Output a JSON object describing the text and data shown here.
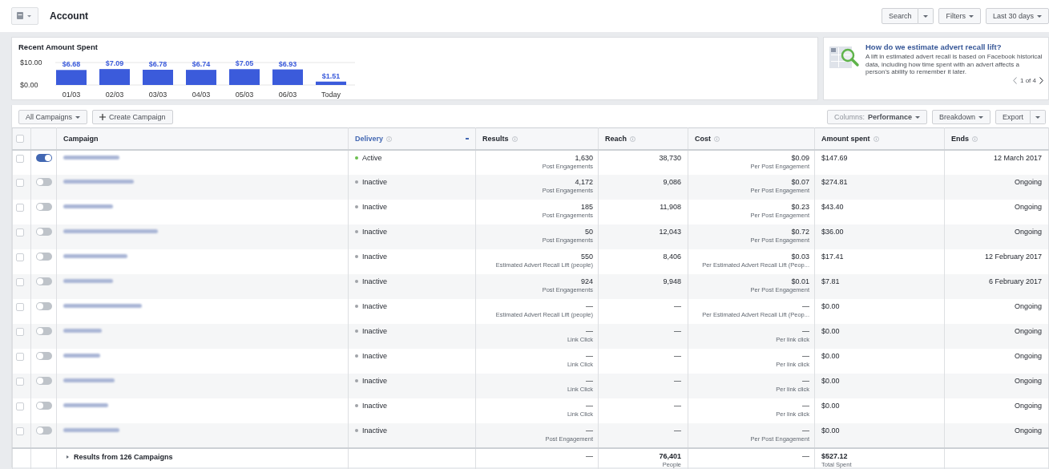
{
  "header": {
    "title": "Account",
    "buttons": [
      {
        "label": "Search",
        "kind": "split"
      },
      {
        "label": "Filters",
        "kind": "dropdown"
      },
      {
        "label": "Last 30 days",
        "kind": "dropdown"
      }
    ]
  },
  "spend_panel": {
    "title": "Recent Amount Spent",
    "chart_data": {
      "type": "bar",
      "categories": [
        "01/03",
        "02/03",
        "03/03",
        "04/03",
        "05/03",
        "06/03",
        "Today"
      ],
      "values": [
        6.68,
        7.09,
        6.78,
        6.74,
        7.05,
        6.93,
        1.51
      ],
      "yticks": [
        {
          "value": 0,
          "label": "$0.00"
        },
        {
          "value": 10,
          "label": "$10.00"
        }
      ],
      "ylim": [
        0,
        10
      ],
      "value_labels": [
        "$6.68",
        "$7.09",
        "$6.78",
        "$6.74",
        "$7.05",
        "$6.93",
        "$1.51"
      ]
    }
  },
  "tip_panel": {
    "title": "How do we estimate advert recall lift?",
    "text": "A lift in estimated advert recall is based on Facebook historical data, including how time spent with an advert affects a person's ability to remember it later.",
    "pager": "1 of 4"
  },
  "toolbar": {
    "left": [
      {
        "label": "All Campaigns",
        "kind": "dropdown"
      },
      {
        "label": "Create Campaign",
        "kind": "create"
      }
    ],
    "right": [
      {
        "label": "Columns:",
        "value": "Performance",
        "kind": "columns"
      },
      {
        "label": "Breakdown",
        "kind": "dropdown"
      },
      {
        "label": "Export",
        "kind": "split"
      }
    ]
  },
  "table": {
    "select_all": {
      "checked": false
    },
    "columns": [
      {
        "label": "Campaign",
        "info": false,
        "sorted": false
      },
      {
        "label": "Delivery",
        "info": true,
        "sorted": true
      },
      {
        "label": "Results",
        "info": true,
        "sorted": false
      },
      {
        "label": "Reach",
        "info": true,
        "sorted": false
      },
      {
        "label": "Cost",
        "info": true,
        "sorted": false
      },
      {
        "label": "Amount spent",
        "info": true,
        "sorted": false
      },
      {
        "label": "Ends",
        "info": true,
        "sorted": false
      }
    ],
    "rows": [
      {
        "checked": false,
        "on": true,
        "delivery": "Active",
        "color": "#6bbf4e",
        "results": "1,630",
        "results_type": "Post Engagements",
        "reach": "38,730",
        "cost": "$0.09",
        "cost_type": "Per Post Engagement",
        "spent": "$147.69",
        "ends": "12 March 2017"
      },
      {
        "checked": false,
        "on": false,
        "delivery": "Inactive",
        "color": "#a0a3a8",
        "results": "4,172",
        "results_type": "Post Engagements",
        "reach": "9,086",
        "cost": "$0.07",
        "cost_type": "Per Post Engagement",
        "spent": "$274.81",
        "ends": "Ongoing"
      },
      {
        "checked": false,
        "on": false,
        "delivery": "Inactive",
        "color": "#a0a3a8",
        "results": "185",
        "results_type": "Post Engagements",
        "reach": "11,908",
        "cost": "$0.23",
        "cost_type": "Per Post Engagement",
        "spent": "$43.40",
        "ends": "Ongoing"
      },
      {
        "checked": false,
        "on": false,
        "delivery": "Inactive",
        "color": "#a0a3a8",
        "results": "50",
        "results_type": "Post Engagements",
        "reach": "12,043",
        "cost": "$0.72",
        "cost_type": "Per Post Engagement",
        "spent": "$36.00",
        "ends": "Ongoing"
      },
      {
        "checked": false,
        "on": false,
        "delivery": "Inactive",
        "color": "#a0a3a8",
        "results": "550",
        "results_type": "Estimated Advert Recall Lift (people)",
        "reach": "8,406",
        "cost": "$0.03",
        "cost_type": "Per Estimated Advert Recall Lift (Peop...",
        "spent": "$17.41",
        "ends": "12 February 2017"
      },
      {
        "checked": false,
        "on": false,
        "delivery": "Inactive",
        "color": "#a0a3a8",
        "results": "924",
        "results_type": "Post Engagements",
        "reach": "9,948",
        "cost": "$0.01",
        "cost_type": "Per Post Engagement",
        "spent": "$7.81",
        "ends": "6 February 2017"
      },
      {
        "checked": false,
        "on": false,
        "delivery": "Inactive",
        "color": "#a0a3a8",
        "results": "—",
        "results_type": "Estimated Advert Recall Lift (people)",
        "reach": "—",
        "cost": "—",
        "cost_type": "Per Estimated Advert Recall Lift (Peop...",
        "spent": "$0.00",
        "ends": "Ongoing"
      },
      {
        "checked": false,
        "on": false,
        "delivery": "Inactive",
        "color": "#a0a3a8",
        "results": "—",
        "results_type": "Link Click",
        "reach": "—",
        "cost": "—",
        "cost_type": "Per link click",
        "spent": "$0.00",
        "ends": "Ongoing"
      },
      {
        "checked": false,
        "on": false,
        "delivery": "Inactive",
        "color": "#a0a3a8",
        "results": "—",
        "results_type": "Link Click",
        "reach": "—",
        "cost": "—",
        "cost_type": "Per link click",
        "spent": "$0.00",
        "ends": "Ongoing"
      },
      {
        "checked": false,
        "on": false,
        "delivery": "Inactive",
        "color": "#a0a3a8",
        "results": "—",
        "results_type": "Link Click",
        "reach": "—",
        "cost": "—",
        "cost_type": "Per link click",
        "spent": "$0.00",
        "ends": "Ongoing"
      },
      {
        "checked": false,
        "on": false,
        "delivery": "Inactive",
        "color": "#a0a3a8",
        "results": "—",
        "results_type": "Link Click",
        "reach": "—",
        "cost": "—",
        "cost_type": "Per link click",
        "spent": "$0.00",
        "ends": "Ongoing"
      },
      {
        "checked": false,
        "on": false,
        "delivery": "Inactive",
        "color": "#a0a3a8",
        "results": "—",
        "results_type": "Post Engagement",
        "reach": "—",
        "cost": "—",
        "cost_type": "Per Post Engagement",
        "spent": "$0.00",
        "ends": "Ongoing"
      }
    ],
    "footer": {
      "label": "Results from 126 Campaigns",
      "results": "—",
      "reach": "76,401",
      "reach_type": "People",
      "cost": "—",
      "spent": "$527.12",
      "spent_type": "Total Spent"
    }
  }
}
